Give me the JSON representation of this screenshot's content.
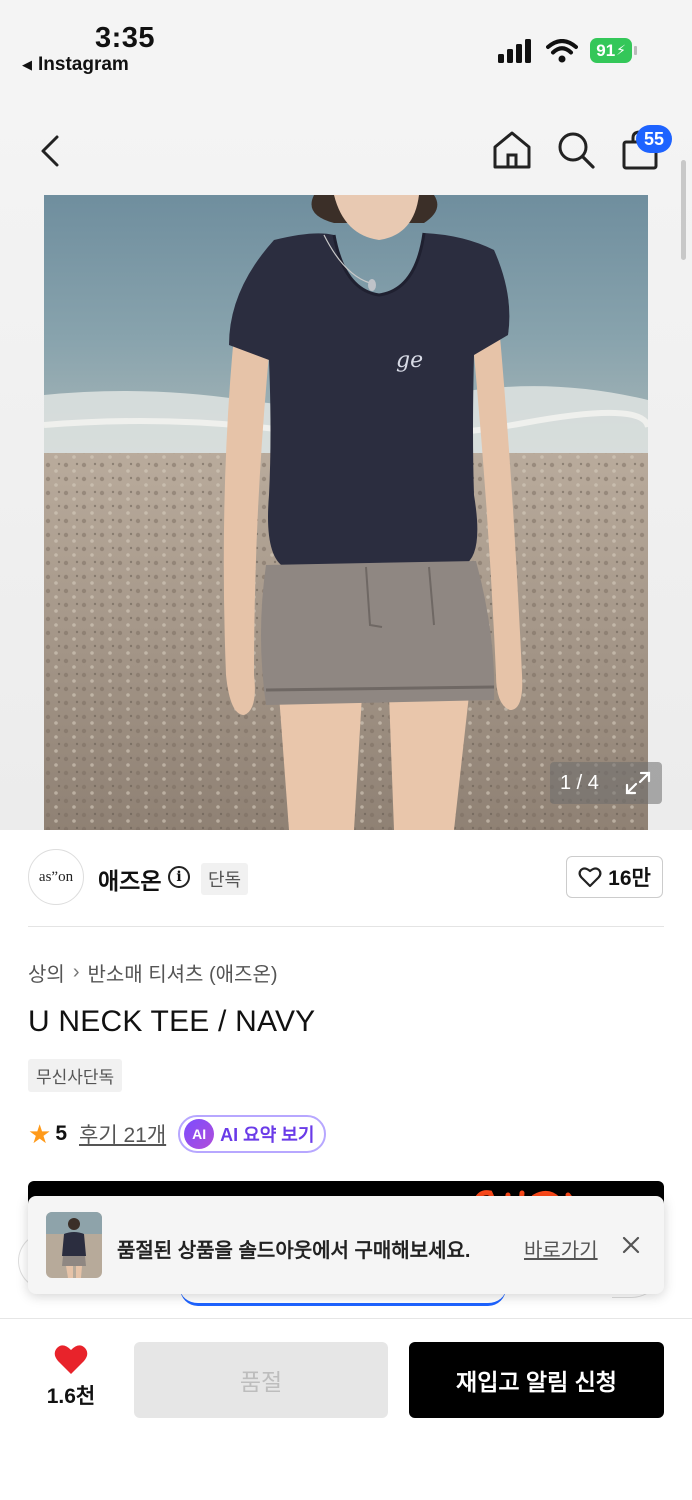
{
  "status_bar": {
    "time": "3:35",
    "back_app": "Instagram",
    "battery": "91"
  },
  "nav": {
    "bag_count": "55"
  },
  "gallery": {
    "counter": "1 / 4"
  },
  "brand": {
    "logo_text": "as”on",
    "name": "애즈온",
    "exclusive_tag": "단독",
    "likes": "16만"
  },
  "product": {
    "breadcrumb": [
      "상의",
      "반소매 티셔츠 (애즈온)"
    ],
    "title": "U NECK TEE / NAVY",
    "tag": "무신사단독",
    "rating": "5",
    "review_link": "후기 21개",
    "ai_badge": "AI",
    "ai_summary": "AI 요약 보기"
  },
  "toast": {
    "message": "품절된 상품을 솔드아웃에서 구매해보세요.",
    "link": "바로가기"
  },
  "bottom": {
    "wish_count": "1.6천",
    "soldout_label": "품절",
    "restock_label": "재입고 알림 신청"
  },
  "colors": {
    "accent_blue": "#1e63ff",
    "ai_purple": "#6a3be8",
    "star": "#ff9a1a",
    "heart": "#e8232b",
    "battery_green": "#34c759"
  }
}
